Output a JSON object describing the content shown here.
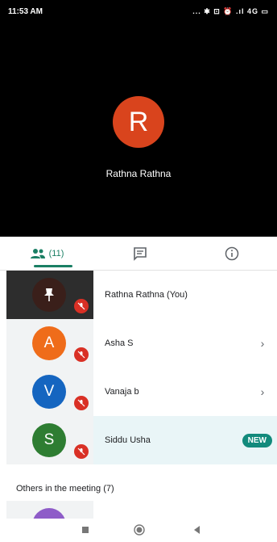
{
  "status_bar": {
    "time": "11:53 AM",
    "indicators": "... ✱ ⊡ ⏰ .ıl 4G ▭"
  },
  "presenter": {
    "initial": "R",
    "name": "Rathna Rathna",
    "avatar_color": "#d9441d"
  },
  "tabs": {
    "people_count": "(11)",
    "active": "people"
  },
  "participants": [
    {
      "name": "Rathna Rathna (You)",
      "muted": true,
      "self": true,
      "avatar_icon": "pin-icon"
    },
    {
      "name": "Asha S",
      "initial": "A",
      "avatar_color": "#ef6c1a",
      "muted": true,
      "chevron": "›"
    },
    {
      "name": "Vanaja b",
      "initial": "V",
      "avatar_color": "#1565c0",
      "muted": true,
      "chevron": "›"
    },
    {
      "name": "Siddu Usha",
      "initial": "S",
      "avatar_color": "#2e7d32",
      "muted": true,
      "badge": "NEW"
    }
  ],
  "others_section": {
    "label": "Others in the meeting (7)"
  },
  "colors": {
    "accent": "#1a7f64",
    "mute": "#d93025",
    "badge": "#128a7c"
  }
}
